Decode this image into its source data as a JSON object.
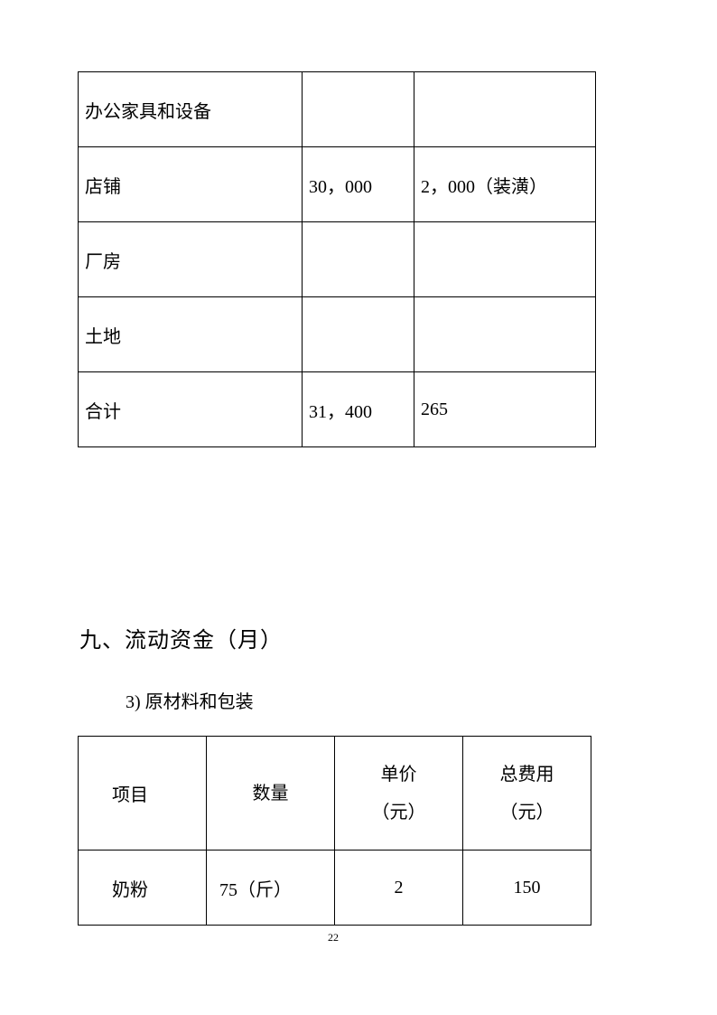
{
  "asset_table": {
    "rows": [
      {
        "item": "办公家具和设备",
        "col2": "",
        "col3": ""
      },
      {
        "item": "店铺",
        "col2": "30，000",
        "col3": "2，000（装潢）"
      },
      {
        "item": "厂房",
        "col2": "",
        "col3": ""
      },
      {
        "item": "土地",
        "col2": "",
        "col3": ""
      },
      {
        "item": "合计",
        "col2": "31，400",
        "col3": "265"
      }
    ]
  },
  "section": {
    "heading": "九、流动资金（月）",
    "subheading": "3) 原材料和包装"
  },
  "materials_table": {
    "headers": [
      {
        "line1": "项目",
        "line2": ""
      },
      {
        "line1": "数量",
        "line2": ""
      },
      {
        "line1": "单价",
        "line2": "（元）"
      },
      {
        "line1": "总费用",
        "line2": "（元）"
      }
    ],
    "rows": [
      {
        "item": "奶粉",
        "quantity": "75（斤）",
        "unit_price": "2",
        "total": "150"
      }
    ]
  },
  "page_number": "22"
}
